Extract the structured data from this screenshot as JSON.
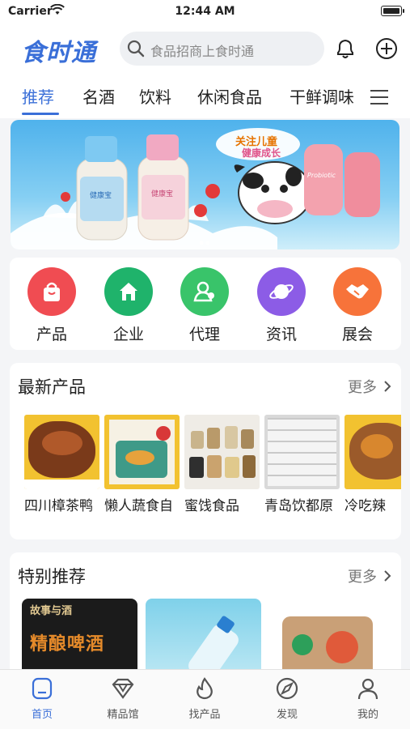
{
  "status_bar": {
    "carrier": "Carrier",
    "time": "12:44 AM"
  },
  "header": {
    "logo": "食时通",
    "search_placeholder": "食品招商上食时通"
  },
  "tabs": [
    "推荐",
    "名酒",
    "饮料",
    "休闲食品",
    "干鲜调味"
  ],
  "banner": {
    "slogan_top": "关注儿童",
    "slogan_bottom": "健康成长",
    "bottle_label": "健康宝",
    "bottle_label_2": "Probiotic"
  },
  "quick_nav": [
    {
      "label": "产品",
      "icon": "bag-icon",
      "color": "#f04c52"
    },
    {
      "label": "企业",
      "icon": "home-icon",
      "color": "#1fb36b"
    },
    {
      "label": "代理",
      "icon": "agent-icon",
      "color": "#39c46a"
    },
    {
      "label": "资讯",
      "icon": "planet-icon",
      "color": "#8c5ce6"
    },
    {
      "label": "展会",
      "icon": "handshake-icon",
      "color": "#f7733a"
    }
  ],
  "latest": {
    "title": "最新产品",
    "more": "更多",
    "items": [
      {
        "name": "四川樟茶鸭"
      },
      {
        "name": "懒人蔬食自"
      },
      {
        "name": "蜜饯食品"
      },
      {
        "name": "青岛饮都原"
      },
      {
        "name": "冷吃辣"
      }
    ]
  },
  "special": {
    "title": "特别推荐",
    "more": "更多",
    "beer_text_top": "故事与酒",
    "beer_text_main": "精酿啤酒"
  },
  "bottom_nav": [
    {
      "label": "首页",
      "icon": "home-tab-icon",
      "active": true
    },
    {
      "label": "精品馆",
      "icon": "diamond-icon",
      "active": false
    },
    {
      "label": "找产品",
      "icon": "flame-icon",
      "active": false
    },
    {
      "label": "发现",
      "icon": "discover-icon",
      "active": false
    },
    {
      "label": "我的",
      "icon": "profile-icon",
      "active": false
    }
  ],
  "colors": {
    "accent": "#3a6fd8"
  }
}
